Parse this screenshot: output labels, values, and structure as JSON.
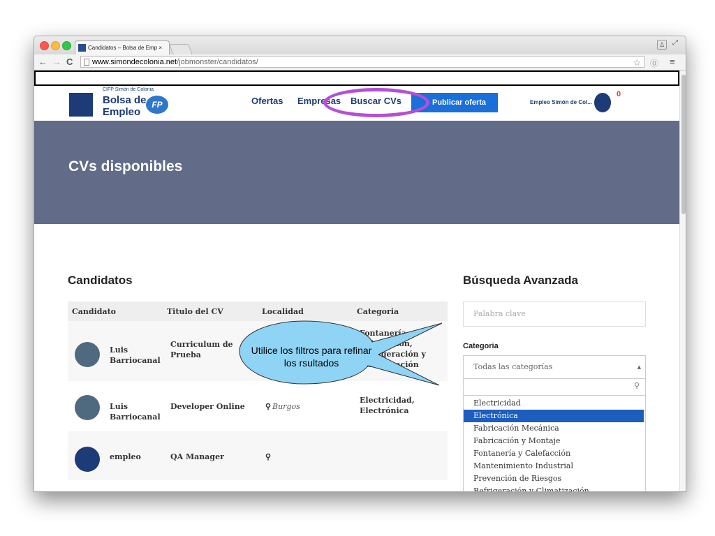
{
  "browser": {
    "tab_title": "Candidatos – Bolsa de Emp ×",
    "url_domain": "www.simondecolonia.net",
    "url_path": "/jobmonster/candidatos/"
  },
  "header": {
    "logo": {
      "cifp": "CIFP Simón de Colonia",
      "line1": "Bolsa de",
      "line2": "Empleo",
      "fp": "FP"
    },
    "menu": [
      "Ofertas",
      "Empresas",
      "Buscar CVs"
    ],
    "publish_button": "Publicar oferta",
    "user": "Empleo Simón de Col...",
    "badge": "0"
  },
  "hero": {
    "title": "CVs disponibles"
  },
  "candidates": {
    "title": "Candidatos",
    "columns": [
      "Candidato",
      "Titulo del CV",
      "Localidad",
      "Categoria"
    ],
    "rows": [
      {
        "name": "Luis Barriocanal",
        "cv": "Curriculum de Prueba",
        "loc": "",
        "cat": "Fontanería, Calefacción, Refrigeración y Climatización"
      },
      {
        "name": "Luis Barriocanal",
        "cv": "Developer Online",
        "loc": "Burgos",
        "cat": "Electricidad, Electrónica"
      },
      {
        "name": "empleo",
        "cv": "QA Manager",
        "loc": "",
        "cat": ""
      }
    ]
  },
  "search": {
    "title": "Búsqueda Avanzada",
    "keyword_placeholder": "Palabra clave",
    "category_label": "Categoria",
    "category_selected": "Todas las categorías",
    "options": [
      "Electricidad",
      "Electrónica",
      "Fabricación Mecánica",
      "Fabricación y Montaje",
      "Fontanería y Calefacción",
      "Mantenimiento Industrial",
      "Prevención de Riesgos",
      "Refrigeración y Climatización"
    ],
    "selected_option": "Electrónica"
  },
  "callout": {
    "text": "Utilice los filtros para refinar los rsultados"
  },
  "colors": {
    "hero": "#626b87",
    "brand": "#1c3b77",
    "publish": "#1a6fd8",
    "highlight": "#b44fd8",
    "callout": "#8fd3f5"
  }
}
